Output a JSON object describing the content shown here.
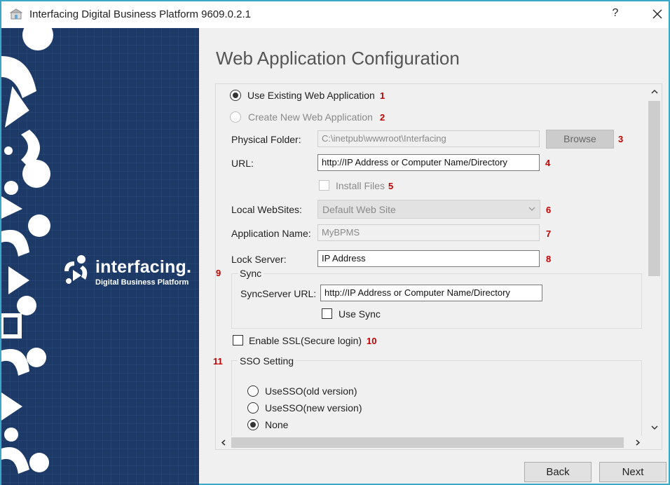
{
  "window": {
    "title": "Interfacing Digital Business Platform 9609.0.2.1",
    "help_label": "?"
  },
  "banner": {
    "logo_word": "interfacing.",
    "logo_sub": "Digital Business Platform",
    "bg_color": "#1d3a67"
  },
  "page": {
    "title": "Web Application Configuration"
  },
  "form": {
    "use_existing": {
      "label": "Use Existing Web Application",
      "checked": true,
      "marker": "1"
    },
    "create_new": {
      "label": "Create New Web Application",
      "checked": false,
      "enabled": false,
      "marker": "2"
    },
    "physical_folder": {
      "label": "Physical Folder:",
      "value": "C:\\inetpub\\wwwroot\\Interfacing",
      "browse_label": "Browse",
      "marker": "3"
    },
    "url": {
      "label": "URL:",
      "value": "http://IP Address or Computer Name/Directory",
      "marker": "4"
    },
    "install_files": {
      "label": "Install Files",
      "checked": false,
      "marker": "5"
    },
    "local_websites": {
      "label": "Local WebSites:",
      "value": "Default Web Site",
      "marker": "6"
    },
    "app_name": {
      "label": "Application Name:",
      "value": "MyBPMS",
      "marker": "7"
    },
    "lock_server": {
      "label": "Lock Server:",
      "value": "IP Address",
      "marker": "8"
    },
    "sync": {
      "title": "Sync",
      "marker": "9",
      "server_url_label": "SyncServer URL:",
      "server_url_value": "http://IP Address or Computer Name/Directory",
      "use_sync_label": "Use Sync",
      "use_sync_checked": false
    },
    "ssl": {
      "label": "Enable SSL(Secure login)",
      "checked": false,
      "marker": "10"
    },
    "sso": {
      "title": "SSO Setting",
      "marker": "11",
      "options": [
        {
          "label": "UseSSO(old version)",
          "checked": false
        },
        {
          "label": "UseSSO(new version)",
          "checked": false
        },
        {
          "label": "None",
          "checked": true
        }
      ]
    }
  },
  "footer": {
    "back_label": "Back",
    "next_label": "Next"
  },
  "colors": {
    "marker": "#c00000",
    "frame_border": "#3aa7c9"
  }
}
